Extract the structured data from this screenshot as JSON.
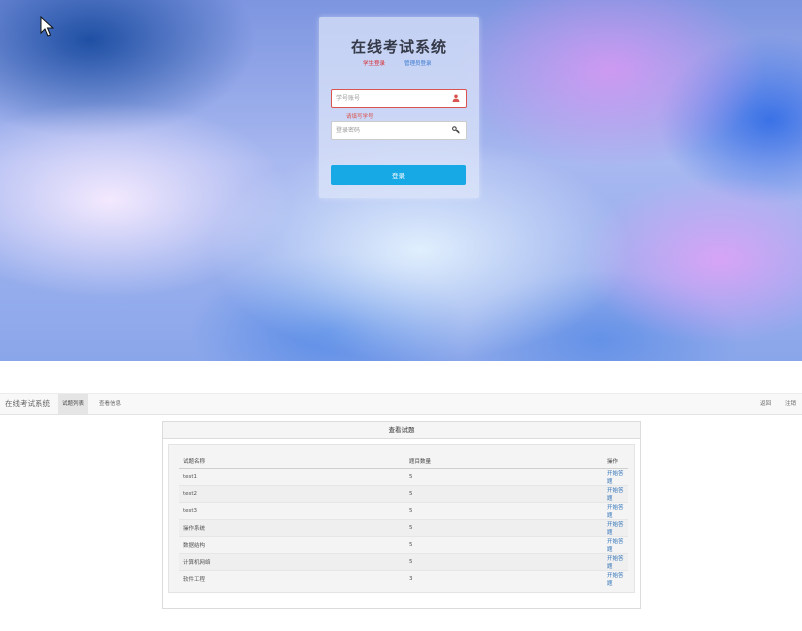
{
  "login": {
    "title": "在线考试系统",
    "tab_student": "学生登录",
    "tab_admin": "管理员登录",
    "username_placeholder": "学号账号",
    "username_icon": "user-icon",
    "error_message": "请填写学号",
    "password_placeholder": "登录密码",
    "password_icon": "key-icon",
    "submit_label": "登录"
  },
  "navbar": {
    "brand": "在线考试系统",
    "items": [
      {
        "label": "试题列表",
        "active": true
      },
      {
        "label": "查看信息",
        "active": false
      }
    ],
    "right_items": [
      {
        "label": "返回"
      },
      {
        "label": "注销"
      }
    ]
  },
  "exam_panel": {
    "title": "查看试题",
    "columns": [
      "试题名称",
      "题目数量",
      "操作"
    ],
    "rows": [
      {
        "name": "test1",
        "count": "5",
        "action": "开始答题"
      },
      {
        "name": "test2",
        "count": "5",
        "action": "开始答题"
      },
      {
        "name": "test3",
        "count": "5",
        "action": "开始答题"
      },
      {
        "name": "操作系统",
        "count": "5",
        "action": "开始答题"
      },
      {
        "name": "数据结构",
        "count": "5",
        "action": "开始答题"
      },
      {
        "name": "计算机网络",
        "count": "5",
        "action": "开始答题"
      },
      {
        "name": "软件工程",
        "count": "3",
        "action": "开始答题"
      }
    ]
  },
  "colors": {
    "login_button": "#17a8e6",
    "error": "#d9534f",
    "link": "#2a6fb6"
  }
}
